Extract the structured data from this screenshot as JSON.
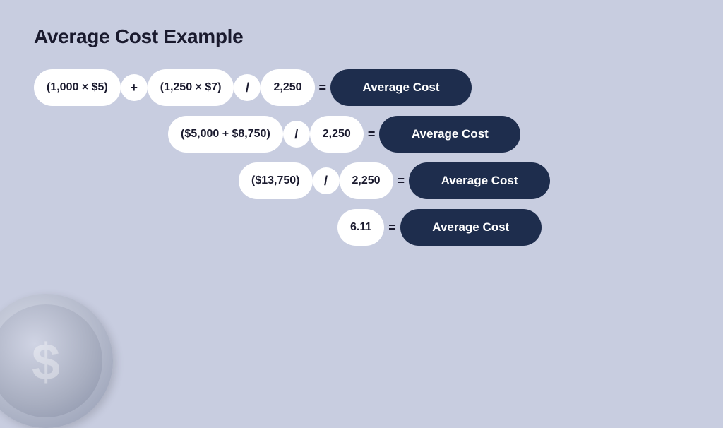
{
  "page": {
    "title": "Average Cost Example",
    "background_color": "#c8cde0"
  },
  "rows": [
    {
      "id": "row1",
      "indent": 0,
      "parts": [
        {
          "type": "pill",
          "text": "(1,000  ×  $5)"
        },
        {
          "type": "operator-circle",
          "text": "+"
        },
        {
          "type": "pill",
          "text": "(1,250  ×  $7)"
        },
        {
          "type": "operator-circle",
          "text": "/"
        },
        {
          "type": "pill",
          "text": "2,250"
        },
        {
          "type": "operator-plain",
          "text": "="
        },
        {
          "type": "result",
          "text": "Average Cost"
        }
      ]
    },
    {
      "id": "row2",
      "indent": 190,
      "parts": [
        {
          "type": "pill",
          "text": "($5,000  +  $8,750)"
        },
        {
          "type": "operator-circle",
          "text": "/"
        },
        {
          "type": "pill",
          "text": "2,250"
        },
        {
          "type": "operator-plain",
          "text": "="
        },
        {
          "type": "result",
          "text": "Average Cost"
        }
      ]
    },
    {
      "id": "row3",
      "indent": 290,
      "parts": [
        {
          "type": "pill",
          "text": "($13,750)"
        },
        {
          "type": "operator-circle",
          "text": "/"
        },
        {
          "type": "pill",
          "text": "2,250"
        },
        {
          "type": "operator-plain",
          "text": "="
        },
        {
          "type": "result",
          "text": "Average Cost"
        }
      ]
    },
    {
      "id": "row4",
      "indent": 430,
      "parts": [
        {
          "type": "pill",
          "text": "6.11"
        },
        {
          "type": "operator-plain",
          "text": "="
        },
        {
          "type": "result",
          "text": "Average Cost"
        }
      ]
    }
  ],
  "coin": {
    "symbol": "$"
  }
}
